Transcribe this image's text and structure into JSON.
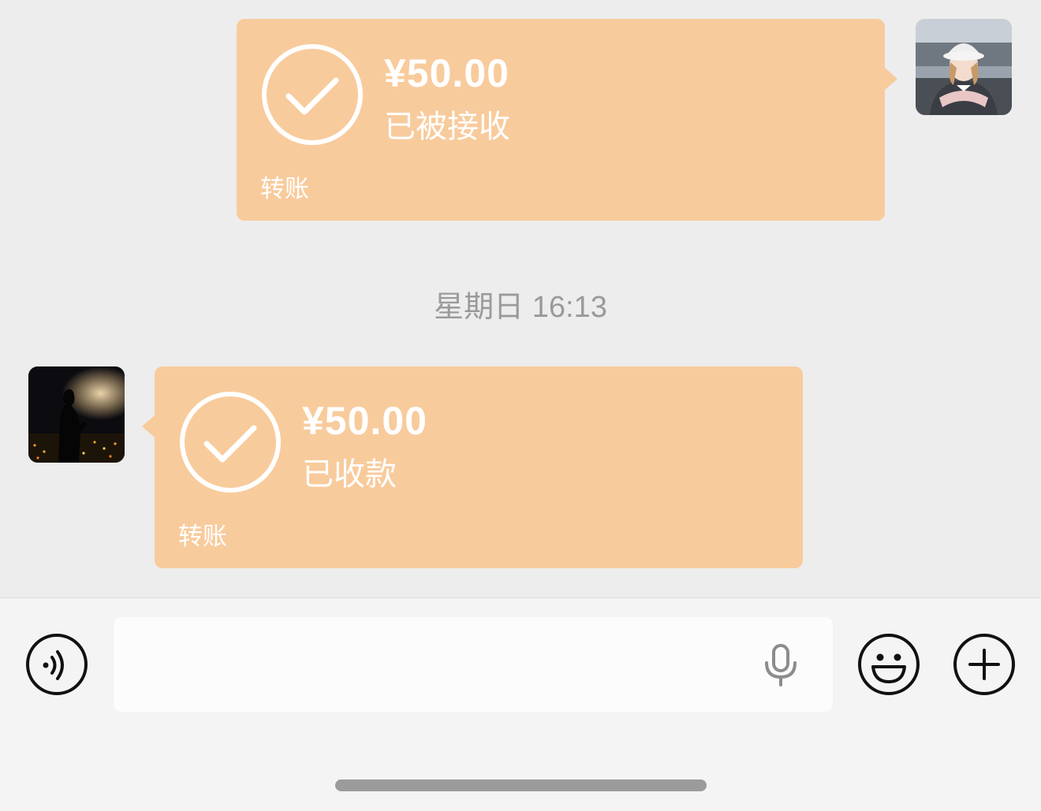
{
  "messages": [
    {
      "side": "right",
      "amount": "¥50.00",
      "status": "已被接收",
      "kind": "转账",
      "avatar_icon": "user-avatar-girl-hat"
    },
    {
      "side": "left",
      "amount": "¥50.00",
      "status": "已收款",
      "kind": "转账",
      "avatar_icon": "user-avatar-night-city"
    }
  ],
  "timestamp": "星期日 16:13",
  "input_bar": {
    "voice_icon": "voice-toggle-icon",
    "text_value": "",
    "mic_icon": "microphone-icon",
    "emoji_icon": "emoji-icon",
    "plus_icon": "plus-icon"
  },
  "colors": {
    "bubble": "#f8cb9c",
    "chat_background": "#ededed",
    "input_background": "#f4f4f4",
    "timestamp_text": "#9a9a9a"
  }
}
